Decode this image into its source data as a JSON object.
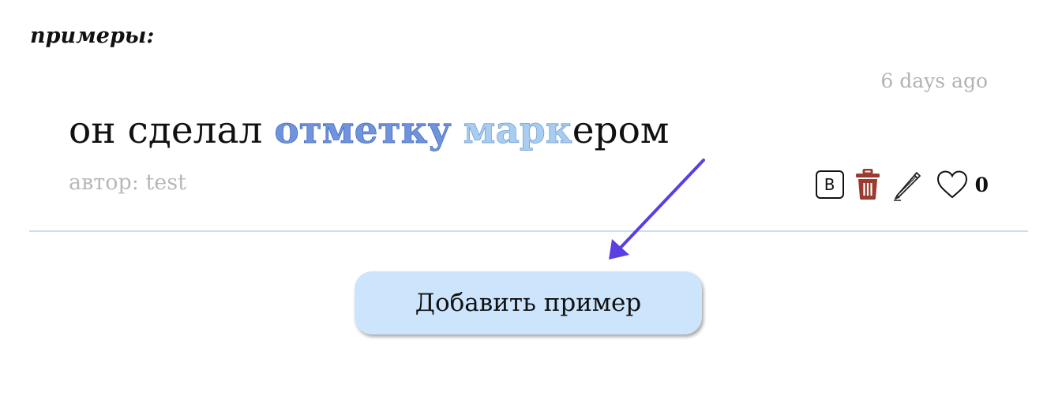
{
  "section": {
    "heading": "примеры:"
  },
  "example": {
    "timestamp": "6 days ago",
    "sentence": {
      "before": "он сделал ",
      "highlight_1": "отметку",
      "space": " ",
      "highlight_2": "марк",
      "after": "ером"
    },
    "author": "автор: test",
    "actions": {
      "badge_label": "B",
      "delete_icon": "trash-icon",
      "edit_icon": "pencil-icon",
      "like_icon": "heart-icon",
      "like_count": "0"
    }
  },
  "add_button": {
    "label": "Добавить пример"
  },
  "colors": {
    "highlight_1": "#6f93dc",
    "highlight_2": "#a8cdf1",
    "trash": "#9b3a2e",
    "divider": "#c4e1f4",
    "button_bg": "#cce5fc",
    "arrow": "#5b3fe0",
    "muted_text": "#b8b8b8"
  }
}
